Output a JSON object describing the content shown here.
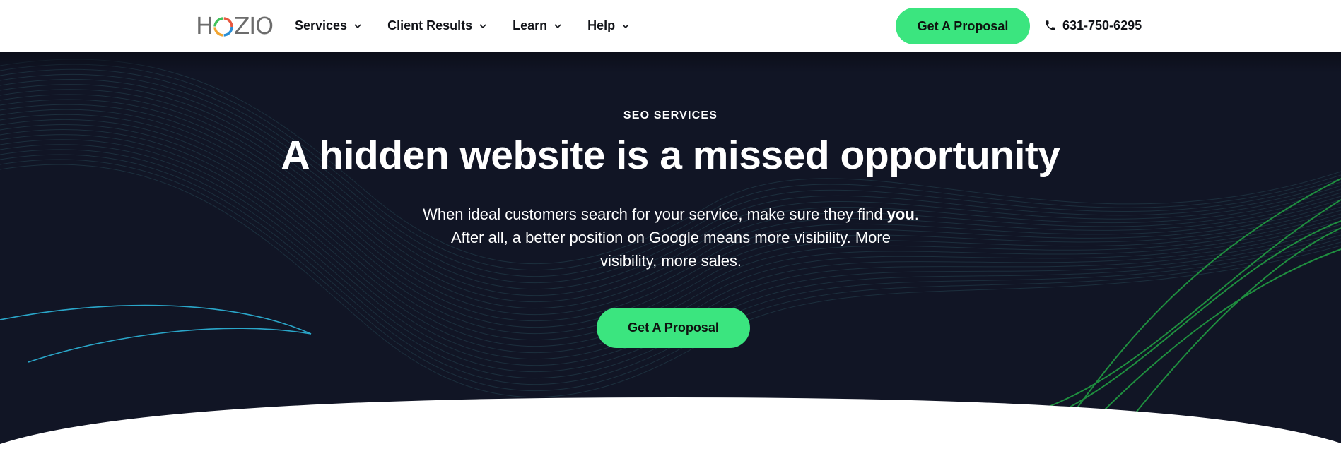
{
  "brand": {
    "logo_text_left": "H",
    "logo_text_right": "ZIO",
    "logo_icon": "swirl-o-icon"
  },
  "nav": {
    "items": [
      {
        "label": "Services",
        "icon": "chevron-down-icon"
      },
      {
        "label": "Client Results",
        "icon": "chevron-down-icon"
      },
      {
        "label": "Learn",
        "icon": "chevron-down-icon"
      },
      {
        "label": "Help",
        "icon": "chevron-down-icon"
      }
    ]
  },
  "header": {
    "cta_label": "Get A Proposal",
    "phone": "631-750-6295",
    "phone_icon": "phone-icon"
  },
  "hero": {
    "eyebrow": "SEO SERVICES",
    "headline": "A hidden website is a missed opportunity",
    "sub_line1_pre": "When ideal customers search for your service, make sure they find ",
    "sub_line1_bold": "you",
    "sub_line1_post": ".",
    "sub_rest": "After all, a better position on Google means more visibility. More visibility, more sales.",
    "cta_label": "Get A Proposal"
  },
  "colors": {
    "accent": "#3be57f",
    "hero_bg": "#111525",
    "text_dark": "#111318",
    "lines_green": "#1f8f3f",
    "lines_blue": "#2aa6c9",
    "lines_teal": "#1d3340"
  }
}
